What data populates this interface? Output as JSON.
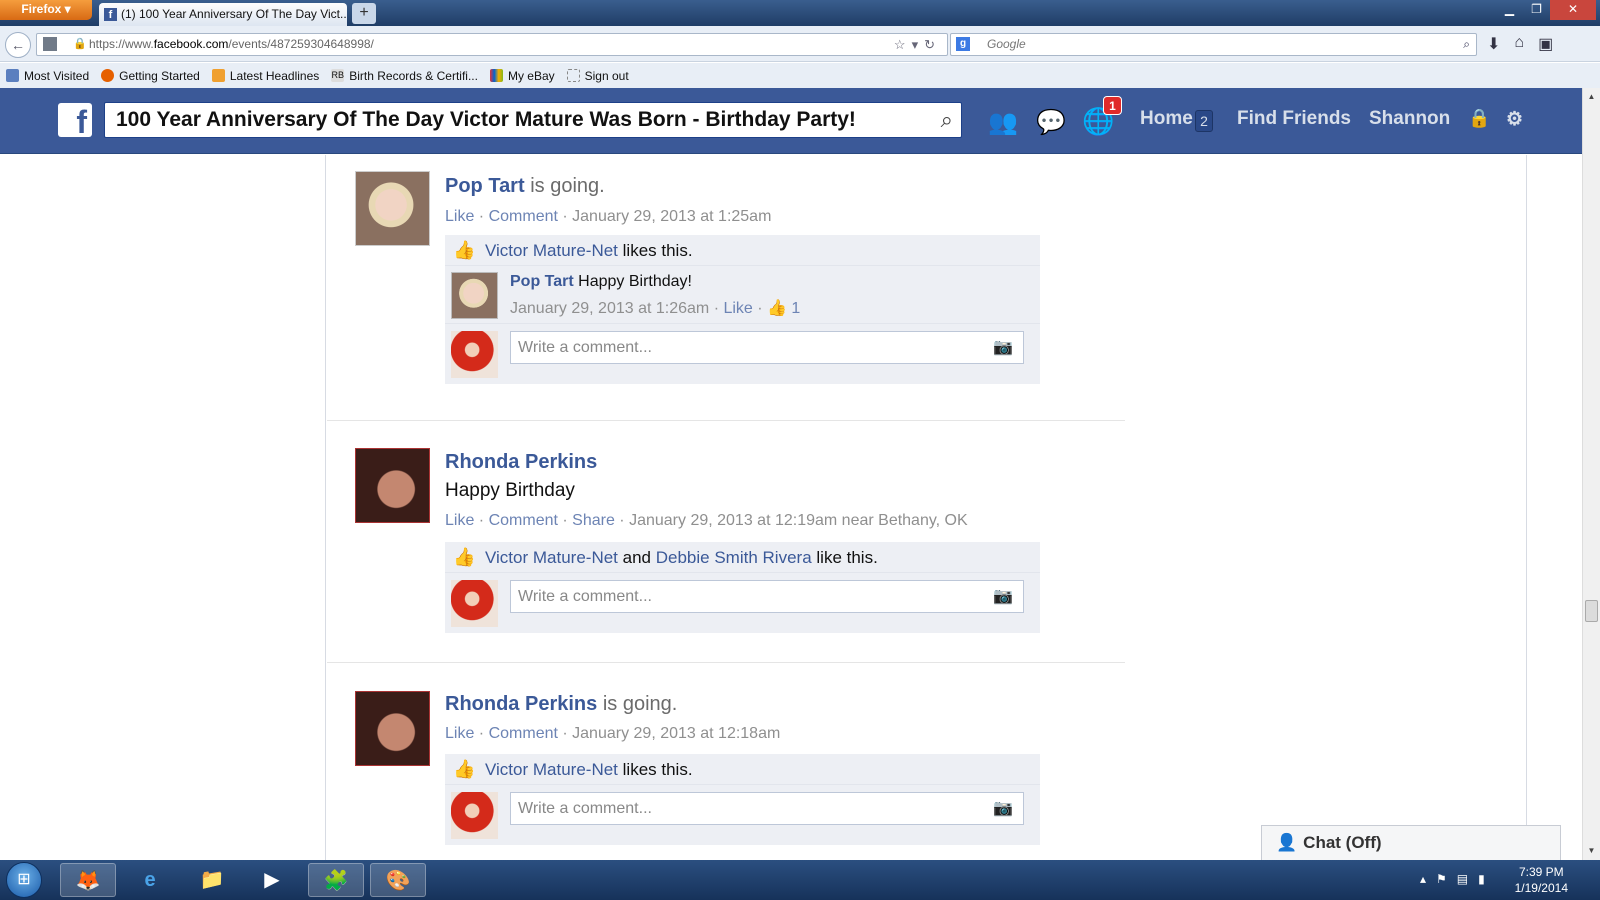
{
  "browser": {
    "firefox_menu": "Firefox",
    "tab_title": "(1) 100 Year Anniversary Of The Day Vict...",
    "new_tab": "+",
    "url_prefix": "https://www.",
    "url_host": "facebook.com",
    "url_path": "/events/487259304648998/",
    "search_placeholder": "Google",
    "bookmarks": [
      "Most Visited",
      "Getting Started",
      "Latest Headlines",
      "Birth Records & Certifi...",
      "My eBay",
      "Sign out"
    ]
  },
  "fb_header": {
    "logo": "f",
    "search_value": "100 Year Anniversary Of The Day Victor Mature Was Born - Birthday Party!",
    "notification_count": "1",
    "home": "Home",
    "home_count": "2",
    "find_friends": "Find Friends",
    "user": "Shannon"
  },
  "posts": [
    {
      "author": "Pop Tart",
      "status": "is going.",
      "actions": [
        "Like",
        "Comment"
      ],
      "time": "January 29, 2013 at 1:25am",
      "likers": [
        "Victor Mature-Net"
      ],
      "like_suffix": "likes this.",
      "reply": {
        "author": "Pop Tart",
        "text": "Happy Birthday!",
        "time": "January 29, 2013 at 1:26am",
        "like": "Like",
        "like_count": "1"
      },
      "write_placeholder": "Write a comment..."
    },
    {
      "author": "Rhonda Perkins",
      "text": "Happy Birthday",
      "actions": [
        "Like",
        "Comment",
        "Share"
      ],
      "time": "January 29, 2013 at 12:19am near Bethany, OK",
      "likers": [
        "Victor Mature-Net",
        "Debbie Smith Rivera"
      ],
      "like_joiner": "and",
      "like_suffix": "like this.",
      "write_placeholder": "Write a comment..."
    },
    {
      "author": "Rhonda Perkins",
      "status": "is going.",
      "actions": [
        "Like",
        "Comment"
      ],
      "time": "January 29, 2013 at 12:18am",
      "likers": [
        "Victor Mature-Net"
      ],
      "like_suffix": "likes this.",
      "write_placeholder": "Write a comment..."
    }
  ],
  "chat": "Chat (Off)",
  "taskbar": {
    "time": "7:39 PM",
    "date": "1/19/2014"
  }
}
